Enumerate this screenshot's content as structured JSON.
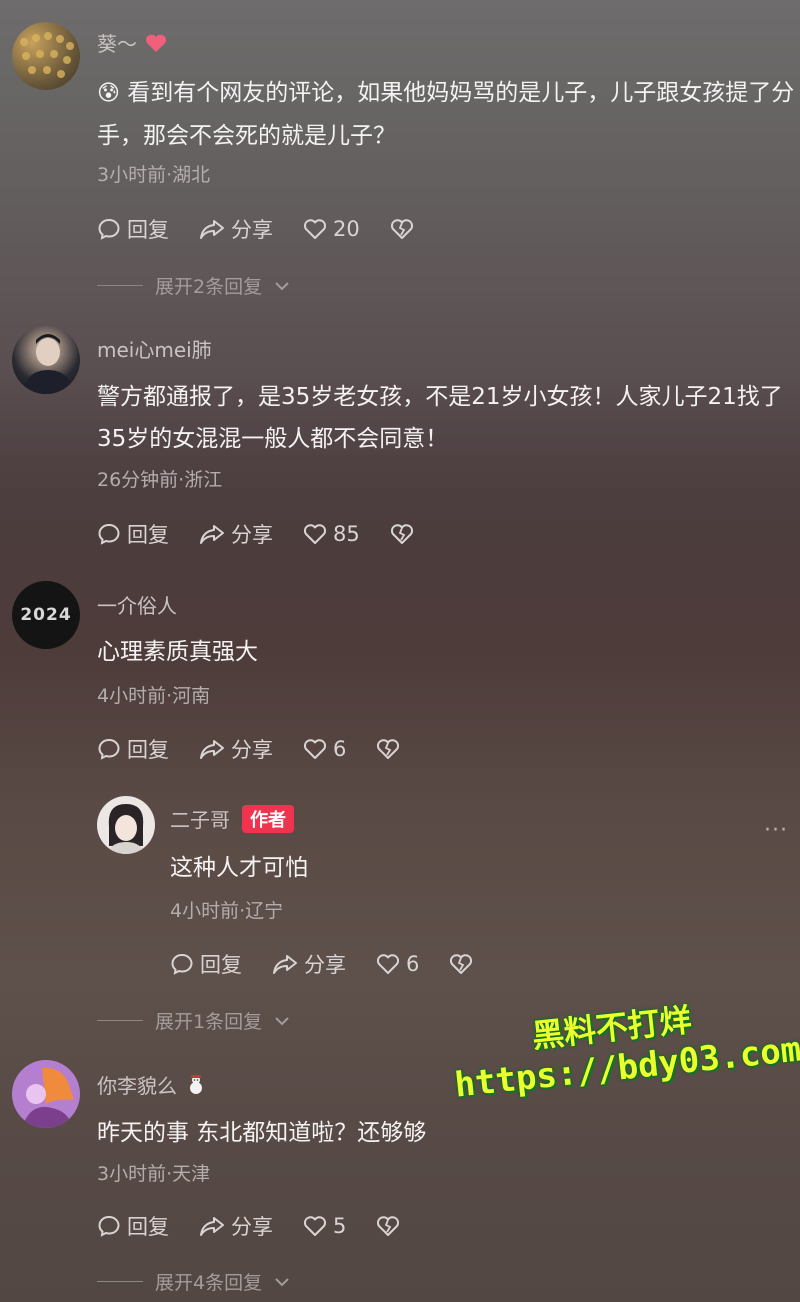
{
  "actions": {
    "reply_label": "回复",
    "share_label": "分享"
  },
  "comments": [
    {
      "name": "葵～",
      "text": "看到有个网友的评论，如果他妈妈骂的是儿子，儿子跟女孩提了分手，那会不会死的就是儿子？",
      "emoji": "😰",
      "meta": "3小时前·湖北",
      "likes": "20",
      "expand": "展开2条回复"
    },
    {
      "name": "mei心mei肺",
      "text": "警方都通报了，是35岁老女孩，不是21岁小女孩！人家儿子21找了35岁的女混混一般人都不会同意！",
      "meta": "26分钟前·浙江",
      "likes": "85"
    },
    {
      "name": "一介俗人",
      "avatar_text": "2024",
      "text": "心理素质真强大",
      "meta": "4小时前·河南",
      "likes": "6"
    },
    {
      "name": "你李貌么",
      "text": "昨天的事 东北都知道啦？还够够",
      "meta": "3小时前·天津",
      "likes": "5",
      "expand": "展开4条回复"
    }
  ],
  "reply": {
    "name": "二子哥",
    "badge": "作者",
    "text": "这种人才可怕",
    "meta": "4小时前·辽宁",
    "likes": "6",
    "expand": "展开1条回复",
    "more": "···"
  },
  "watermark": {
    "line1": "黑料不打烊",
    "line2": "https://bdy03.com"
  },
  "colors": {
    "badge": "#f0344f",
    "watermark": "#eaff2c"
  }
}
